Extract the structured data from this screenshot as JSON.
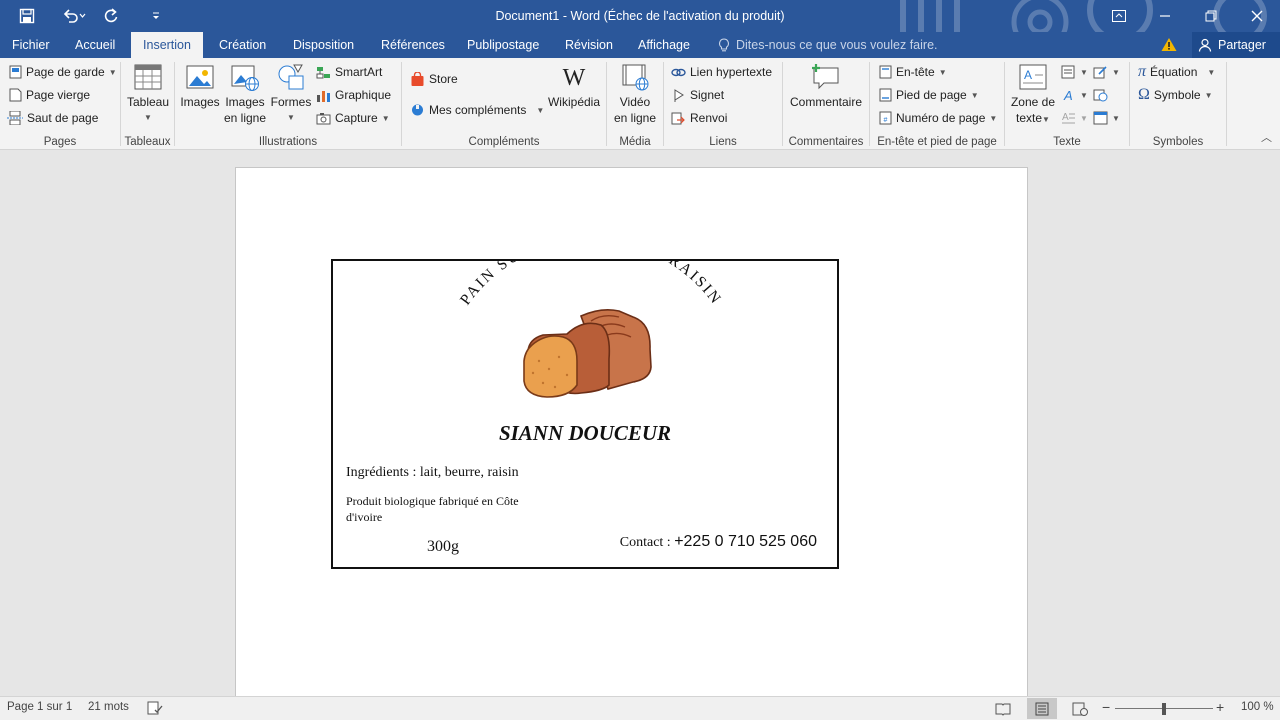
{
  "window": {
    "title": "Document1 - Word (Échec de l'activation du produit)",
    "share_label": "Partager",
    "tell_me_placeholder": "Dites-nous ce que vous voulez faire."
  },
  "menu": {
    "tabs": [
      "Fichier",
      "Accueil",
      "Insertion",
      "Création",
      "Disposition",
      "Références",
      "Publipostage",
      "Révision",
      "Affichage"
    ],
    "active_tab": "Insertion"
  },
  "ribbon": {
    "pages": {
      "label": "Pages",
      "cover": "Page de garde",
      "blank": "Page vierge",
      "break": "Saut de page"
    },
    "tableaux": {
      "label": "Tableaux",
      "table": "Tableau"
    },
    "illustrations": {
      "label": "Illustrations",
      "images": "Images",
      "online_images_1": "Images",
      "online_images_2": "en ligne",
      "shapes": "Formes",
      "smartart": "SmartArt",
      "chart": "Graphique",
      "capture": "Capture"
    },
    "complements": {
      "label": "Compléments",
      "store": "Store",
      "my_addins": "Mes compléments",
      "wikipedia": "Wikipédia"
    },
    "media": {
      "label": "Média",
      "video_1": "Vidéo",
      "video_2": "en ligne"
    },
    "liens": {
      "label": "Liens",
      "hyperlink": "Lien hypertexte",
      "bookmark": "Signet",
      "crossref": "Renvoi"
    },
    "commentaires": {
      "label": "Commentaires",
      "comment": "Commentaire"
    },
    "header_footer": {
      "label": "En-tête et pied de page",
      "header": "En-tête",
      "footer": "Pied de page",
      "page_number": "Numéro de page"
    },
    "texte": {
      "label": "Texte",
      "textbox_1": "Zone de",
      "textbox_2": "texte"
    },
    "symboles": {
      "label": "Symboles",
      "equation": "Équation",
      "symbol": "Symbole"
    }
  },
  "document": {
    "arc_title": "PAIN SUCRÉ AU LAIT ET RAISIN",
    "brand": "SIANN DOUCEUR",
    "ingredients": "Ingrédients : lait, beurre, raisin",
    "product_line_1": "Produit biologique fabriqué en Côte",
    "product_line_2": "d'ivoire",
    "weight": "300g",
    "contact_label": "Contact : ",
    "contact_phone": "+225 0 710 525 060"
  },
  "status": {
    "page": "Page 1 sur 1",
    "words": "21 mots",
    "zoom": "100 %",
    "zoom_level": 1.0
  },
  "colors": {
    "accent": "#2b579a",
    "bread_crust": "#c8744a",
    "bread_crumb": "#eaa04e"
  }
}
